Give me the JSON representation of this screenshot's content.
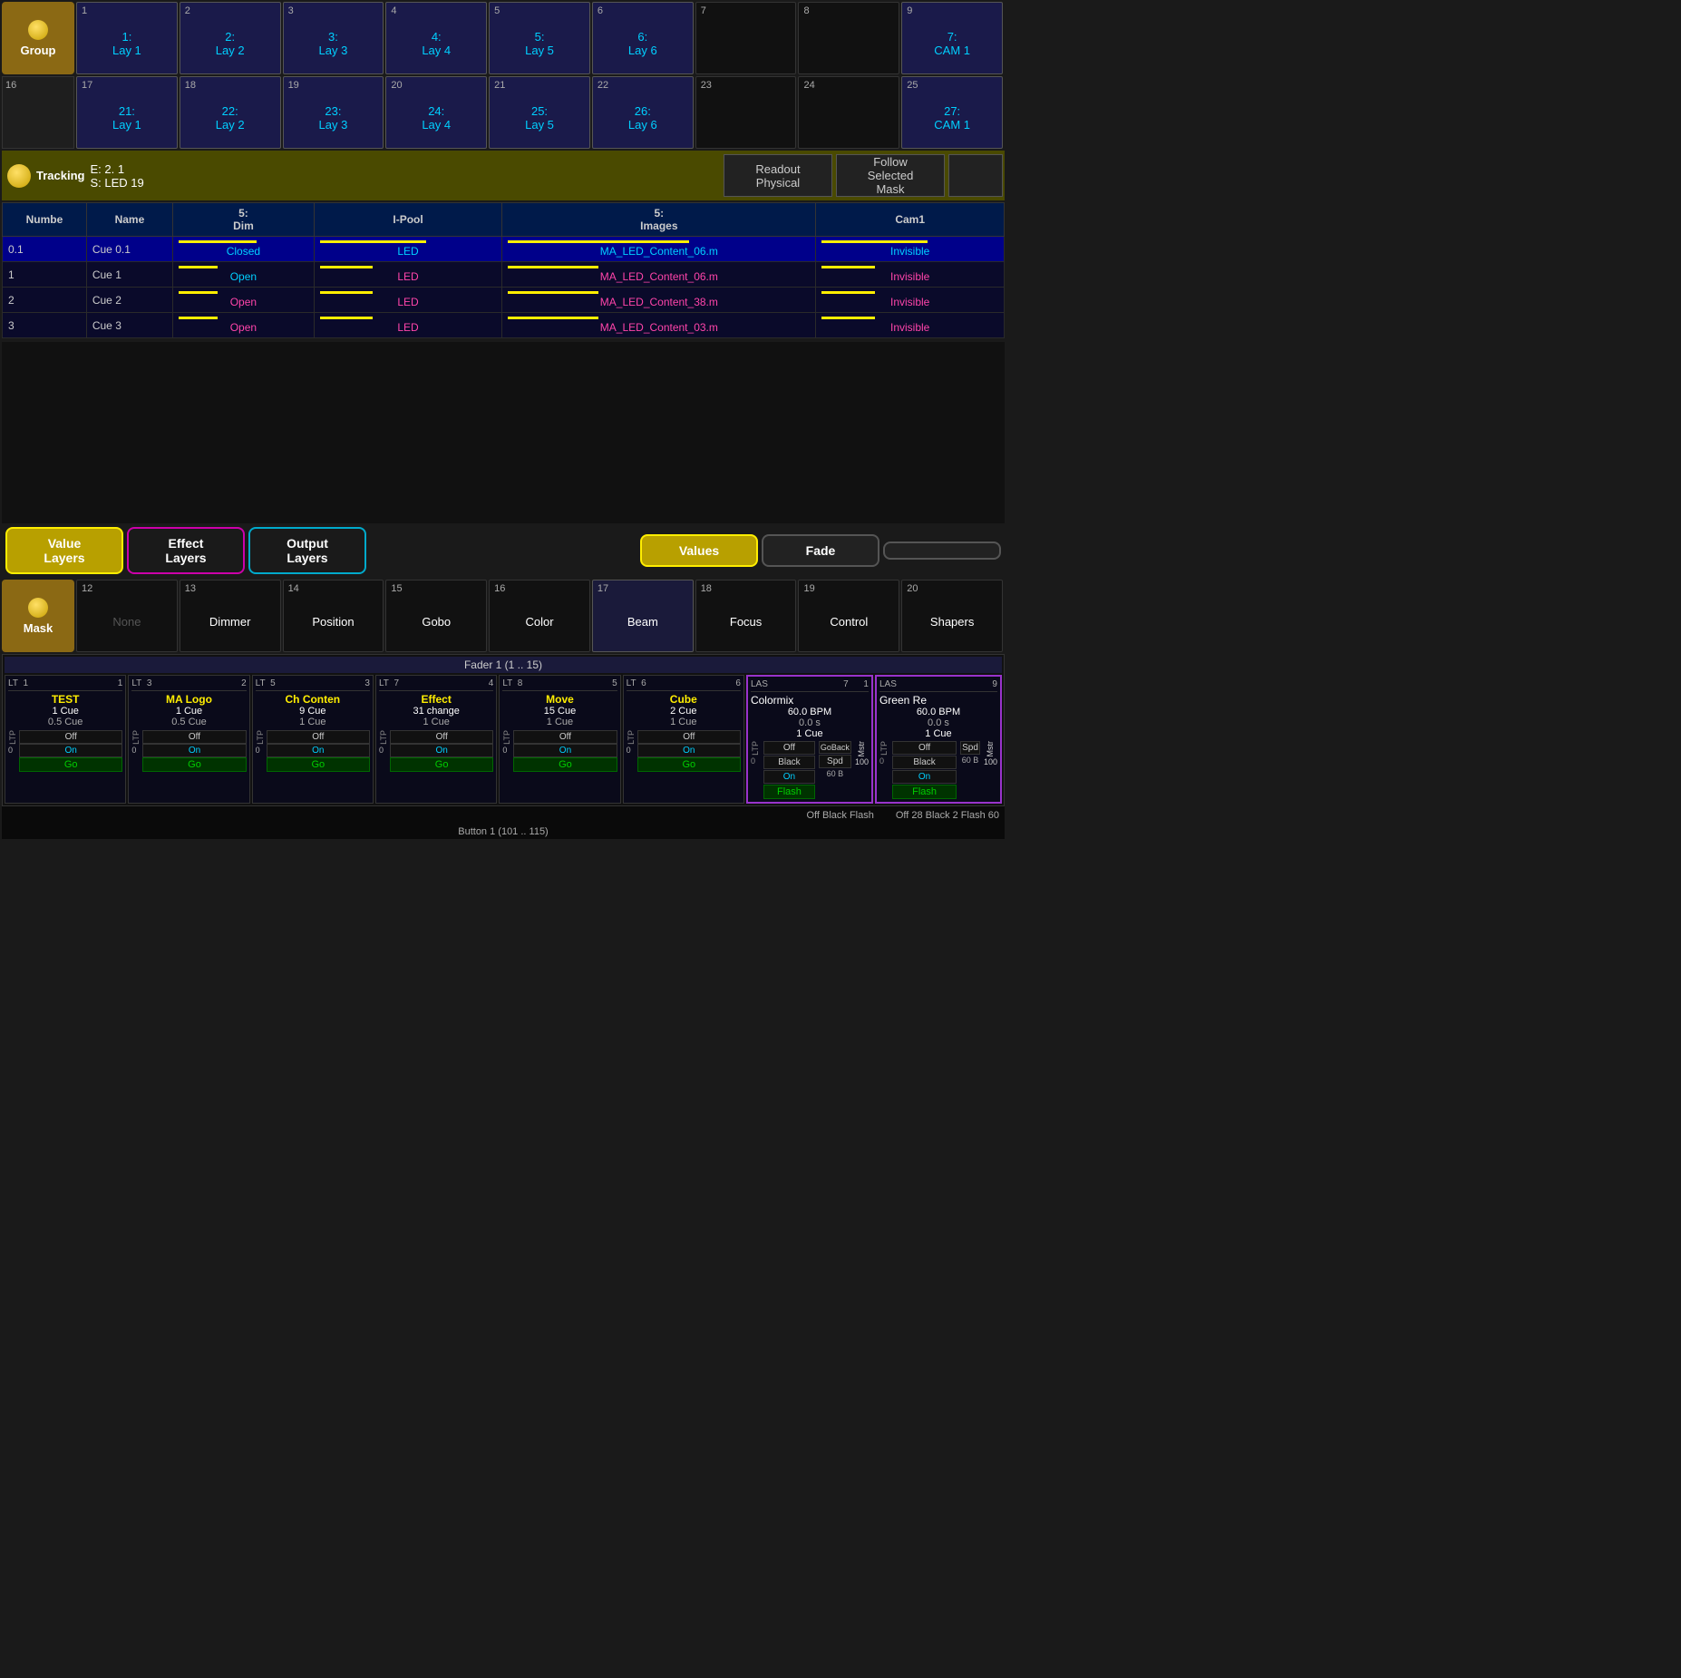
{
  "group_section": {
    "row1": {
      "label": "Group",
      "cells": [
        {
          "num": "1",
          "name": "1:\nLay 1",
          "active": true
        },
        {
          "num": "2",
          "name": "2:\nLay 2",
          "active": true
        },
        {
          "num": "3",
          "name": "3:\nLay 3",
          "active": true
        },
        {
          "num": "4",
          "name": "4:\nLay 4",
          "active": true
        },
        {
          "num": "5",
          "name": "5:\nLay 5",
          "active": true
        },
        {
          "num": "6",
          "name": "6:\nLay 6",
          "active": true
        },
        {
          "num": "7",
          "name": "",
          "active": false
        },
        {
          "num": "8",
          "name": "",
          "active": false
        },
        {
          "num": "9",
          "name": "7:\nCAM 1",
          "active": true
        }
      ]
    },
    "row2": {
      "row_num": "16",
      "cells": [
        {
          "num": "17",
          "name": "21:\nLay 1",
          "active": true
        },
        {
          "num": "18",
          "name": "22:\nLay 2",
          "active": true
        },
        {
          "num": "19",
          "name": "23:\nLay 3",
          "active": true
        },
        {
          "num": "20",
          "name": "24:\nLay 4",
          "active": true
        },
        {
          "num": "21",
          "name": "25:\nLay 5",
          "active": true
        },
        {
          "num": "22",
          "name": "26:\nLay 6",
          "active": true
        },
        {
          "num": "23",
          "name": "",
          "active": false
        },
        {
          "num": "24",
          "name": "",
          "active": false
        },
        {
          "num": "25",
          "name": "27:\nCAM 1",
          "active": true
        }
      ]
    }
  },
  "tracking": {
    "e_val": "E:  2. 1",
    "s_val": "S: LED 19",
    "btn1": "Readout\nPhysical",
    "btn2": "Follow\nSelected\nMask"
  },
  "cue_table": {
    "headers": [
      "Numbe",
      "Name",
      "5:\nDim",
      "I-Pool",
      "5:\nImages",
      "Cam1"
    ],
    "rows": [
      {
        "num": "0.1",
        "name": "Cue 0.1",
        "dim": "Closed",
        "pool": "LED",
        "images": "MA_LED_Content_06.m",
        "cam": "Invisible",
        "style": "selected"
      },
      {
        "num": "1",
        "name": "Cue 1",
        "dim": "Open",
        "pool": "LED",
        "images": "MA_LED_Content_06.m",
        "cam": "Invisible",
        "style": "normal"
      },
      {
        "num": "2",
        "name": "Cue 2",
        "dim": "Open",
        "pool": "LED",
        "images": "MA_LED_Content_38.m",
        "cam": "Invisible",
        "style": "normal"
      },
      {
        "num": "3",
        "name": "Cue 3",
        "dim": "Open",
        "pool": "LED",
        "images": "MA_LED_Content_03.m",
        "cam": "Invisible",
        "style": "normal"
      }
    ]
  },
  "layer_buttons": {
    "btn1": "Value\nLayers",
    "btn2": "Effect\nLayers",
    "btn3": "Output\nLayers",
    "btn4": "Values",
    "btn5": "Fade"
  },
  "mask": {
    "label": "Mask",
    "cells": [
      {
        "num": "12",
        "name": "None",
        "gray": true
      },
      {
        "num": "13",
        "name": "Dimmer",
        "gray": false
      },
      {
        "num": "14",
        "name": "Position",
        "gray": false
      },
      {
        "num": "15",
        "name": "Gobo",
        "gray": false
      },
      {
        "num": "16",
        "name": "Color",
        "gray": false
      },
      {
        "num": "17",
        "name": "Beam",
        "gray": false
      },
      {
        "num": "18",
        "name": "Focus",
        "gray": false
      },
      {
        "num": "19",
        "name": "Control",
        "gray": false
      },
      {
        "num": "20",
        "name": "Shapers",
        "gray": false
      }
    ]
  },
  "fader": {
    "header": "Fader  1 (1 .. 15)",
    "tracks": [
      {
        "lt_num": "1",
        "lt_id": "1",
        "name": "TEST",
        "cue1": "1 Cue",
        "cue2": "0.5 Cue",
        "off": "Off",
        "on": "On",
        "go": "Go"
      },
      {
        "lt_num": "2",
        "lt_id": "3",
        "name": "MA Logo",
        "cue1": "1 Cue",
        "cue2": "0.5 Cue",
        "off": "Off",
        "on": "On",
        "go": "Go"
      },
      {
        "lt_num": "3",
        "lt_id": "5",
        "name": "Ch Conten",
        "cue1": "9 Cue",
        "cue2": "1 Cue",
        "off": "Off",
        "on": "On",
        "go": "Go"
      },
      {
        "lt_num": "4",
        "lt_id": "7",
        "name": "Effect",
        "cue1": "31 change",
        "cue2": "1 Cue",
        "off": "Off",
        "on": "On",
        "go": "Go"
      },
      {
        "lt_num": "5",
        "lt_id": "8",
        "name": "Move",
        "cue1": "15 Cue",
        "cue2": "1 Cue",
        "off": "Off",
        "on": "On",
        "go": "Go"
      },
      {
        "lt_num": "6",
        "lt_id": "6",
        "name": "Cube",
        "cue1": "2 Cue",
        "cue2": "1 Cue",
        "off": "Off",
        "on": "On",
        "go": "Go"
      }
    ],
    "colormix": {
      "lt_num": "7",
      "lt_id": "1",
      "name": "LAS\nColormix",
      "bpm": "60.0 BPM",
      "time": "0.0 s",
      "cue1": "1 Cue",
      "off": "Off",
      "black": "Black",
      "flash": "Flash",
      "goback": "GoBack",
      "on": "On",
      "spd": "Spd",
      "bpm2": "60 B",
      "mstr": "Mstr\n100"
    },
    "greenre": {
      "lt_num": "9",
      "name": "LAS\nGreen Re",
      "bpm": "60.0 BPM",
      "time": "0.0 s",
      "cue1": "1 Cue",
      "off": "Off",
      "black": "Black",
      "flash": "Flash",
      "on": "On",
      "mstr": "Mstr\n100",
      "spd": "Spd",
      "bpm2": "60 B"
    }
  },
  "bottom_labels": {
    "off_black_flash": "Off Black Flash",
    "off_28_black_2_flash_60": "Off 28 Black 2 Flash 60",
    "button_label": "Button  1 (101 .. 115)"
  }
}
